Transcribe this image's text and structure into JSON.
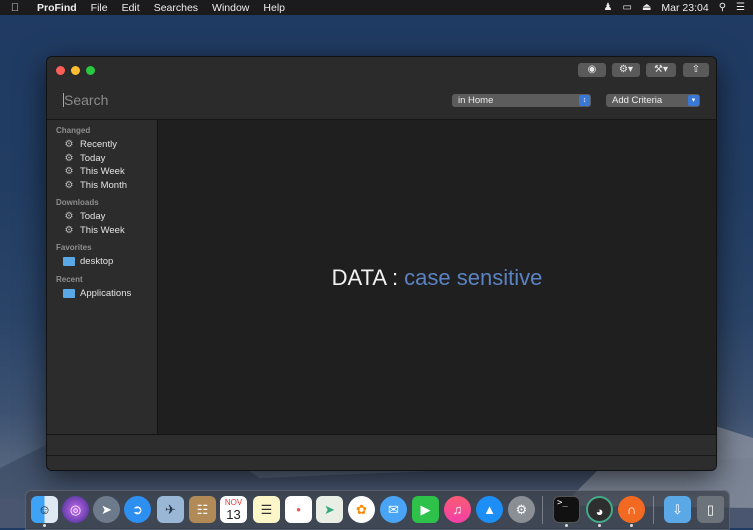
{
  "menubar": {
    "app_name": "ProFind",
    "items": [
      "File",
      "Edit",
      "Searches",
      "Window",
      "Help"
    ],
    "clock": "Mar 23:04"
  },
  "window": {
    "search": {
      "placeholder": "Search"
    },
    "scope_select": "in Home",
    "criteria_select": "Add Criteria",
    "sidebar": {
      "sections": [
        {
          "title": "Changed",
          "items": [
            "Recently",
            "Today",
            "This Week",
            "This Month"
          ]
        },
        {
          "title": "Downloads",
          "items": [
            "Today",
            "This Week"
          ]
        },
        {
          "title": "Favorites",
          "items": [
            "desktop"
          ]
        },
        {
          "title": "Recent",
          "items": [
            "Applications"
          ]
        }
      ]
    },
    "main": {
      "message_prefix": "DATA : ",
      "message_highlight": "case sensitive"
    }
  },
  "dock": {
    "calendar_month": "NOV",
    "calendar_day": "13"
  },
  "colors": {
    "accent": "#3b77d5",
    "highlight": "#5b83c2"
  }
}
